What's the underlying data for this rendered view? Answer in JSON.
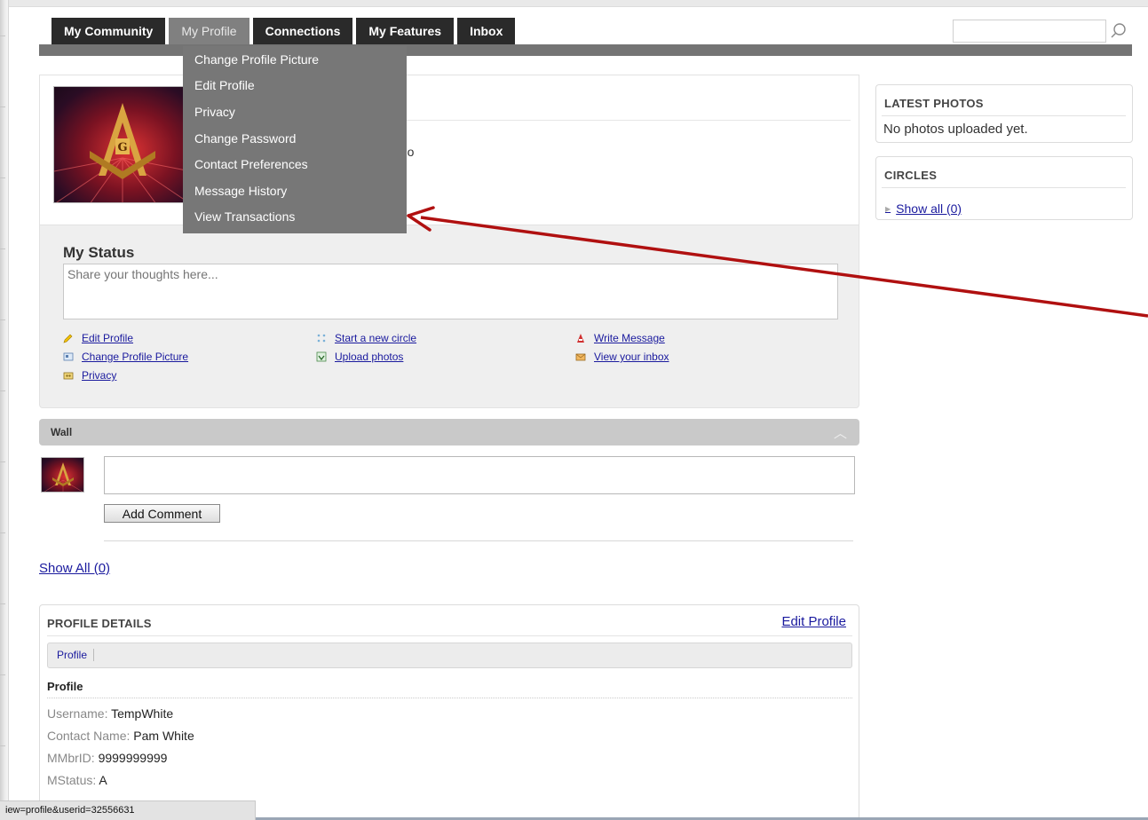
{
  "nav": {
    "tabs": [
      {
        "label": "My Community"
      },
      {
        "label": "My Profile"
      },
      {
        "label": "Connections"
      },
      {
        "label": "My Features"
      },
      {
        "label": "Inbox"
      }
    ],
    "active_tab": "My Profile",
    "search_placeholder": ""
  },
  "profile_menu": {
    "items": [
      {
        "label": "Change Profile Picture"
      },
      {
        "label": "Edit Profile"
      },
      {
        "label": "Privacy"
      },
      {
        "label": "Change Password"
      },
      {
        "label": "Contact Preferences"
      },
      {
        "label": "Message History"
      },
      {
        "label": "View Transactions"
      }
    ]
  },
  "profile_card": {
    "last_seen_fragment": "ago"
  },
  "status": {
    "title": "My Status",
    "placeholder": "Share your thoughts here...",
    "links": [
      {
        "label": "Edit Profile",
        "icon": "pencil-icon"
      },
      {
        "label": "Change Profile Picture",
        "icon": "picture-icon"
      },
      {
        "label": "Privacy",
        "icon": "privacy-icon"
      },
      {
        "label": "Start a new circle",
        "icon": "circle-icon"
      },
      {
        "label": "Upload photos",
        "icon": "upload-icon"
      },
      {
        "label": "Write Message",
        "icon": "write-message-icon"
      },
      {
        "label": "View your inbox",
        "icon": "inbox-icon"
      }
    ]
  },
  "wall": {
    "title": "Wall",
    "add_comment_label": "Add Comment",
    "show_all_label": "Show All (0)"
  },
  "profile_details": {
    "title": "PROFILE DETAILS",
    "edit_label": "Edit Profile",
    "tab_label": "Profile",
    "section_title": "Profile",
    "fields": [
      {
        "label": "Username:",
        "value": "TempWhite"
      },
      {
        "label": "Contact Name:",
        "value": "Pam White"
      },
      {
        "label": "MMbrID:",
        "value": "9999999999"
      },
      {
        "label": "MStatus:",
        "value": "A"
      }
    ]
  },
  "sidebar": {
    "latest_photos": {
      "title": "LATEST PHOTOS",
      "empty_text": "No photos uploaded yet."
    },
    "circles": {
      "title": "CIRCLES",
      "link_label": "Show all (0)"
    }
  },
  "statusbar": {
    "url": "iew=profile&userid=32556631"
  },
  "colors": {
    "accent_link": "#1a1a9e",
    "tab_dark": "#2a2a2a",
    "menu_bg": "#777777",
    "annotation_arrow": "#b01010"
  }
}
